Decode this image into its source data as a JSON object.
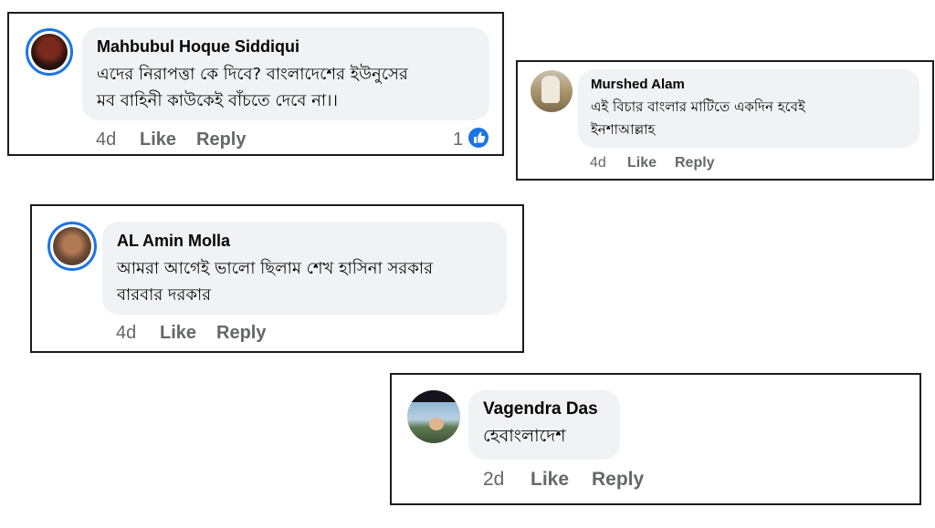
{
  "comments": [
    {
      "author": "Mahbubul Hoque Siddiqui",
      "text": "এদের নিরাপত্তা কে দিবে? বাংলাদেশের ইউনুসের\nমব বাহিনী কাউকেই বাঁচতে দেবে না।।",
      "time": "4d",
      "like_label": "Like",
      "reply_label": "Reply",
      "reaction_count": "1",
      "reaction_icon": "thumbs-up-icon"
    },
    {
      "author": "Murshed Alam",
      "text": "এই বিচার বাংলার মাটিতে একদিন হবেই\nইনশাআল্লাহ",
      "time": "4d",
      "like_label": "Like",
      "reply_label": "Reply"
    },
    {
      "author": "AL Amin Molla",
      "text": "আমরা আগেই ভালো ছিলাম শেখ হাসিনা সরকার\nবারবার দরকার",
      "time": "4d",
      "like_label": "Like",
      "reply_label": "Reply"
    },
    {
      "author": "Vagendra Das",
      "text": "হেবাংলাদেশ",
      "time": "2d",
      "like_label": "Like",
      "reply_label": "Reply"
    }
  ],
  "colors": {
    "accent": "#1b74e4",
    "bubble": "#f0f2f5",
    "meta_text": "#65676b",
    "border": "#1c1c1c"
  }
}
